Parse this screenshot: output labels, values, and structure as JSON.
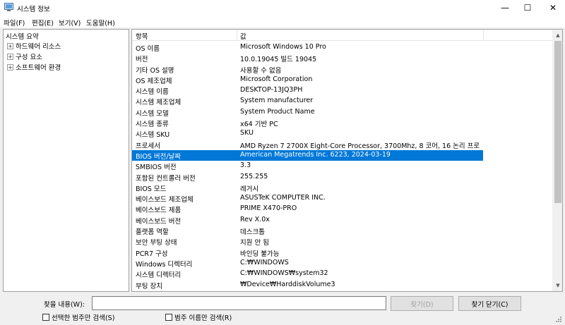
{
  "window": {
    "title": "시스템 정보",
    "controls": {
      "minimize": "—",
      "maximize": "☐",
      "close": "✕"
    }
  },
  "menu": [
    "파일(F)",
    "편집(E)",
    "보기(V)",
    "도움말(H)"
  ],
  "tree": {
    "root": "시스템 요약",
    "items": [
      {
        "label": "하드웨어 리소스",
        "expander": "+"
      },
      {
        "label": "구성 요소",
        "expander": "+"
      },
      {
        "label": "소프트웨어 환경",
        "expander": "+"
      }
    ]
  },
  "list": {
    "headers": [
      "항목",
      "값"
    ],
    "rows": [
      {
        "item": "OS 이름",
        "value": "Microsoft Windows 10 Pro"
      },
      {
        "item": "버전",
        "value": "10.0.19045 빌드 19045"
      },
      {
        "item": "기타 OS 설명",
        "value": "사용할 수 없음"
      },
      {
        "item": "OS 제조업체",
        "value": "Microsoft Corporation"
      },
      {
        "item": "시스템 이름",
        "value": "DESKTOP-13JQ3PH"
      },
      {
        "item": "시스템 제조업체",
        "value": "System manufacturer"
      },
      {
        "item": "시스템 모델",
        "value": "System Product Name"
      },
      {
        "item": "시스템 종류",
        "value": "x64 기반 PC"
      },
      {
        "item": "시스템 SKU",
        "value": "SKU"
      },
      {
        "item": "프로세서",
        "value": "AMD Ryzen 7 2700X Eight-Core Processor, 3700Mhz, 8 코어, 16 논리 프로..."
      },
      {
        "item": "BIOS 버전/날짜",
        "value": "American Megatrends Inc. 6223, 2024-03-19",
        "selected": true
      },
      {
        "item": "SMBIOS 버전",
        "value": "3.3"
      },
      {
        "item": "포함된 컨트롤러 버전",
        "value": "255.255"
      },
      {
        "item": "BIOS 모드",
        "value": "레거시"
      },
      {
        "item": "베이스보드 제조업체",
        "value": "ASUSTeK COMPUTER INC."
      },
      {
        "item": "베이스보드 제품",
        "value": "PRIME X470-PRO"
      },
      {
        "item": "베이스보드 버전",
        "value": "Rev X.0x"
      },
      {
        "item": "플랫폼 역할",
        "value": "데스크톱"
      },
      {
        "item": "보안 부팅 상태",
        "value": "지원 안 됨"
      },
      {
        "item": "PCR7 구성",
        "value": "바인딩 불가능"
      },
      {
        "item": "Windows 디렉터리",
        "value": "C:₩WINDOWS"
      },
      {
        "item": "시스템 디렉터리",
        "value": "C:₩WINDOWS₩system32"
      },
      {
        "item": "부팅 장치",
        "value": "₩Device₩HarddiskVolume3"
      }
    ]
  },
  "find": {
    "label": "찾을 내용(W):",
    "input_value": "",
    "find_button": "찾기(D)",
    "close_button": "찾기 닫기(C)",
    "check_selected_category": "선택한 범주만 검색(S)",
    "check_category_names": "범주 이름만 검색(R)"
  },
  "colors": {
    "selection": "#0078d7"
  }
}
